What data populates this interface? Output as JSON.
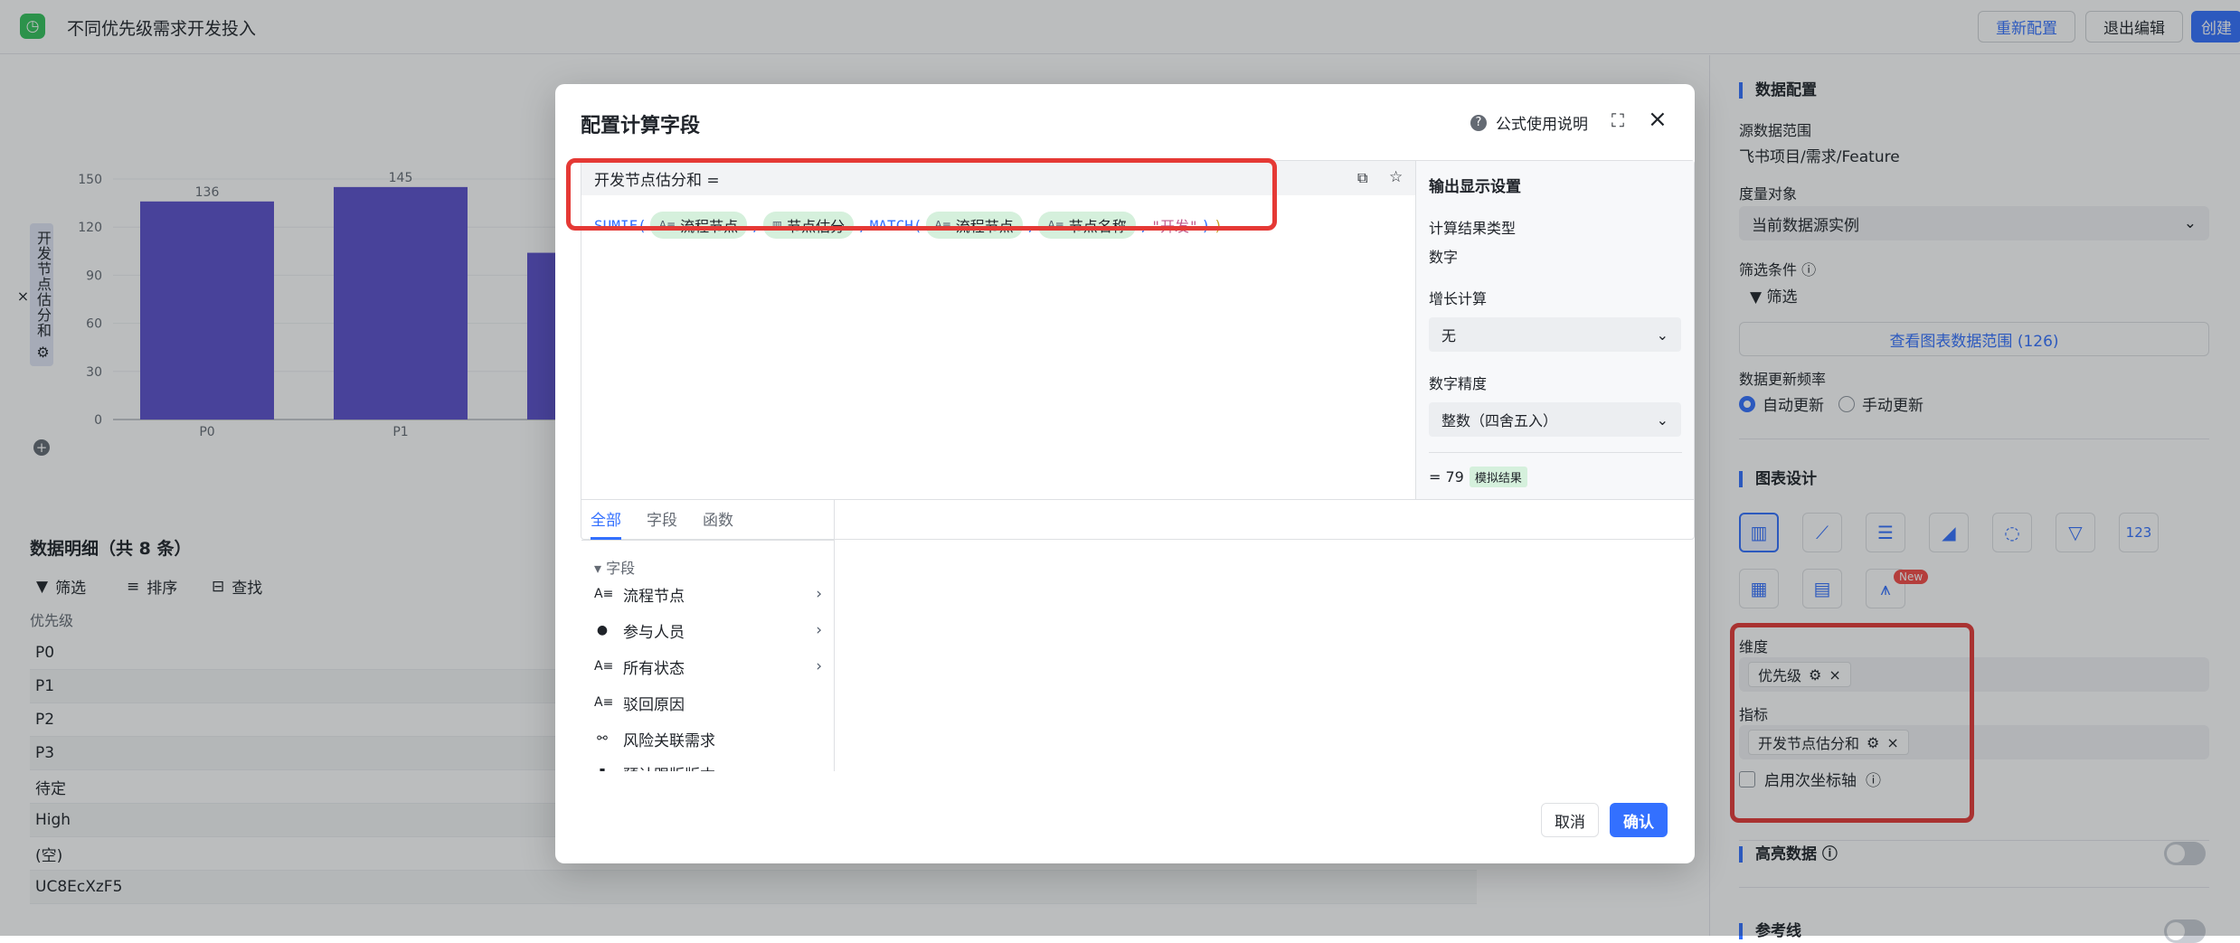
{
  "app": {
    "title": "不同优先级需求开发投入"
  },
  "topbar": {
    "reconfigure": "重新配置",
    "exit_edit": "退出编辑",
    "create": "创建"
  },
  "chart_data": {
    "type": "bar",
    "ylabel": "开发节点估分和",
    "yticks": [
      "150",
      "120",
      "90",
      "60",
      "30",
      "0"
    ],
    "ylim": [
      0,
      150
    ],
    "categories": [
      "P0",
      "P1",
      ""
    ],
    "values": [
      136,
      145,
      104
    ],
    "data_labels": [
      "136",
      "145",
      ""
    ],
    "series_color": "#5b4fcc"
  },
  "detail": {
    "title": "数据明细（共 8 条）",
    "tools": {
      "filter": "筛选",
      "sort": "排序",
      "find": "查找"
    },
    "column": "优先级",
    "rows": [
      "P0",
      "P1",
      "P2",
      "P3",
      "待定",
      "High",
      "(空)",
      "UC8EcXzF5"
    ]
  },
  "config": {
    "data_section": "数据配置",
    "source_label": "源数据范围",
    "source_value": "飞书项目/需求/Feature",
    "measure_label": "度量对象",
    "measure_value": "当前数据源实例",
    "filter_label": "筛选条件",
    "filter_btn": "筛选",
    "view_range": "查看图表数据范围 (126)",
    "freq_label": "数据更新频率",
    "freq_auto": "自动更新",
    "freq_manual": "手动更新",
    "design_section": "图表设计",
    "new_badge": "New",
    "dimension_label": "维度",
    "dimension_chip": "优先级",
    "metric_label": "指标",
    "metric_chip": "开发节点估分和",
    "secondary_axis": "启用次坐标轴",
    "highlight": "高亮数据",
    "refline": "参考线",
    "accent": "#3370ff"
  },
  "dialog": {
    "title": "配置计算字段",
    "help": "公式使用说明",
    "formula_head": "开发节点估分和 =",
    "fn1": "SUMIF(",
    "tok1": "流程节点",
    "tok2": "节点估分",
    "fn2": "MATCH(",
    "tok3": "流程节点",
    "tok4": "节点名称",
    "strval": "\"开发\"",
    "close1": ")",
    "close2": ")",
    "sep": ",",
    "out_title": "输出显示设置",
    "result_type_label": "计算结果类型",
    "result_type": "数字",
    "growth_label": "增长计算",
    "growth_value": "无",
    "precision_label": "数字精度",
    "precision_value": "整数（四舍五入）",
    "result": "= 79",
    "result_tag": "模拟结果",
    "tabs": [
      "全部",
      "字段",
      "函数"
    ],
    "group": "字段",
    "fields": [
      "流程节点",
      "参与人员",
      "所有状态",
      "驳回原因",
      "风险关联需求",
      "预计跟版版本"
    ],
    "cancel": "取消",
    "confirm": "确认"
  }
}
